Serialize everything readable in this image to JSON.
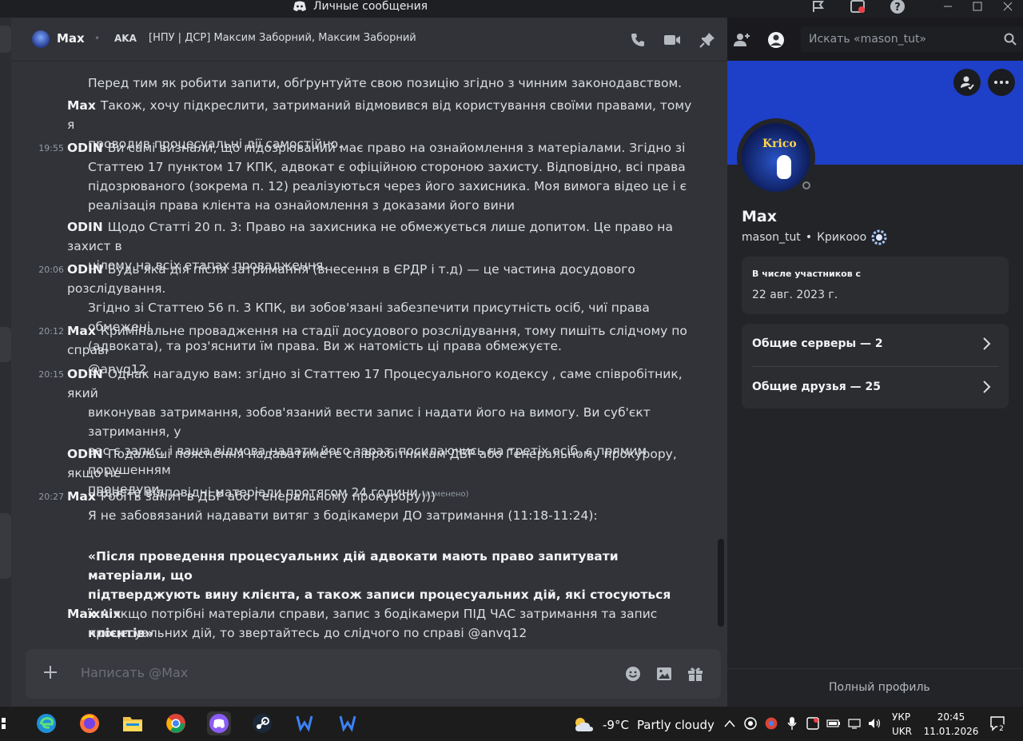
{
  "window": {
    "title": "Личные сообщения"
  },
  "header": {
    "name": "Max",
    "aka_label": "AKA",
    "aka_value": "[НПУ | ДСР] Максим Заборний, Максим Заборний",
    "search_placeholder": "Искать «mason_tut»"
  },
  "messages": [
    {
      "time": "",
      "author": "",
      "lines": [
        "Перед тим як робити запити, обґрунтуйте свою позицію згідно з чинним законодавством."
      ]
    },
    {
      "time": "",
      "author": "Max",
      "lines": [
        "Також, хочу підкреслити, затриманий відмовився від користування своїми правами, тому я",
        "проводив процесуальні дії самостійно."
      ]
    },
    {
      "time": "19:55",
      "author": "ODIN",
      "lines": [
        "Ви самі визнали, що підозрюваний має право на ознайомлення з матеріалами. Згідно зі",
        "Статтею 17 пунктом 17 КПК, адвокат є офіційною стороною захисту. Відповідно, всі права",
        "підозрюваного (зокрема п. 12) реалізуються через його захисника. Моя вимога відео  це і є",
        "реалізація права клієнта на ознайомлення з доказами його вини"
      ]
    },
    {
      "time": "",
      "author": "ODIN",
      "lines": [
        "Щодо Статті 20 п. 3: Право на захисника не обмежується лише допитом. Це право на захист в",
        "цілому на всіх етапах провадження."
      ]
    },
    {
      "time": "20:06",
      "author": "ODIN",
      "lines": [
        "Будь яка дія після затримання (внесення в ЄРДР і т.д) — це частина досудового розслідування.",
        "Згідно зі Статтею 56 п. 3 КПК, ви зобов'язані забезпечити присутність осіб, чиї права обмежені",
        "(адвоката), та роз'яснити їм права. Ви ж натомість ці права обмежуєте."
      ]
    },
    {
      "time": "20:12",
      "author": "Max",
      "lines": [
        "Кримінальне провадження на стадії досудового розслідування, тому пишіть слідчому по справі",
        "@anvq12"
      ]
    },
    {
      "time": "20:15",
      "author": "ODIN",
      "lines": [
        "Однак нагадую вам: згідно зі Статтею 17 Процесуального кодексу , саме співробітник, який",
        "виконував затримання, зобов'язаний вести запис і надати його на вимогу. Ви суб'єкт затримання, у",
        "вас є запис, і ваша відмова надати його зараз, посилаючись на третіх осіб, є прямим порушенням",
        "процедури."
      ]
    },
    {
      "time": "",
      "author": "ODIN",
      "lines": [
        "Подальші пояснення надаватимете співробітникам  ДБР або Генеральному прокурору, якщо не",
        "надасте відповідні матеріали протягом 24 години"
      ],
      "edited": "(изменено)"
    },
    {
      "time": "20:27",
      "author": "Max",
      "lines": [
        "Робіть запит в ДБР або Генеральному прокурору)))",
        "Я не забовязаний надавати витяг з бодікамери ДО затримання (11:18-11:24):"
      ]
    },
    {
      "time": "",
      "author": "",
      "bold": true,
      "lines": [
        " «Після проведення процесуальних дій адвокати мають право запитувати матеріали, що",
        "підтверджують вину клієнта, а також записи процесуальних дій, які стосуються їхніх",
        "клієнтів»"
      ]
    },
    {
      "time": "",
      "author": "Max",
      "lines": [
        "А якщо потрібні матеріали справи, запис з бодікамери ПІД ЧАС затримання та запис",
        "процесуальних дій, то звертайтесь до слідчого по справі @anvq12"
      ]
    }
  ],
  "composer": {
    "placeholder": "Написать @Max"
  },
  "profile": {
    "display_name": "Max",
    "username": "mason_tut",
    "separator": "•",
    "pronoun_or_tag": "Крикооо",
    "avatar_text": "Krico",
    "member_since_label": "В числе участников с",
    "member_since_value": "22 авг. 2023 г.",
    "mutual_servers": "Общие серверы — 2",
    "mutual_friends": "Общие друзья — 25",
    "full_profile": "Полный профиль"
  },
  "taskbar": {
    "weather_temp": "-9°C",
    "weather_text": "Partly cloudy",
    "lang_top": "УКР",
    "lang_bottom": "UKR",
    "time": "20:45",
    "date": "11.01.2026",
    "notif_count": "2"
  },
  "colors": {
    "banner": "#1e3fc8",
    "chat_bg": "#313338",
    "panel_bg": "#232428"
  }
}
